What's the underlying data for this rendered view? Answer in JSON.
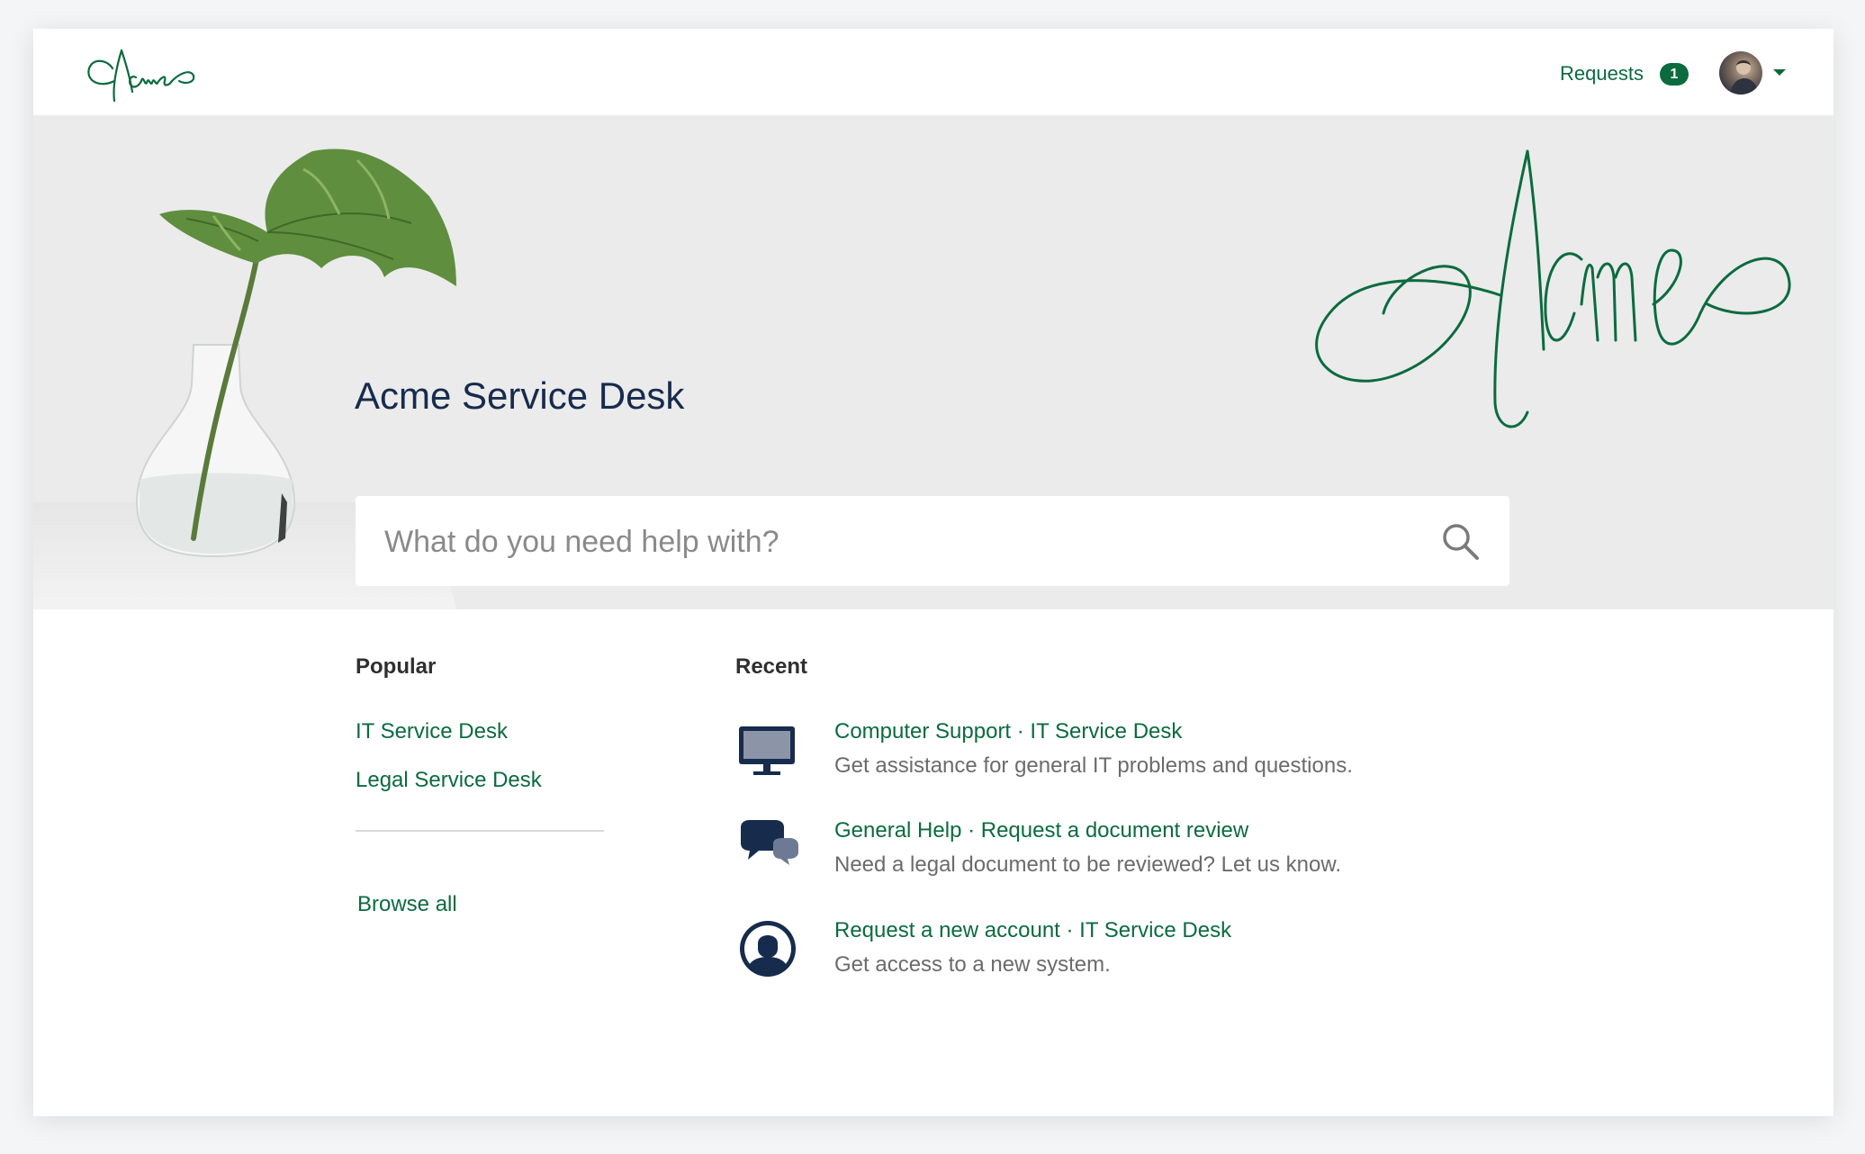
{
  "colors": {
    "brand_green": "#0b6b3f",
    "navy": "#172b4d",
    "banner_bg": "#ebebeb"
  },
  "header": {
    "logo_icon": "acme-script-logo",
    "requests_label": "Requests",
    "requests_count": "1",
    "avatar_icon": "user-avatar"
  },
  "banner": {
    "title": "Acme Service Desk",
    "search_placeholder": "What do you need help with?"
  },
  "popular": {
    "title": "Popular",
    "items": [
      {
        "label": "IT Service Desk"
      },
      {
        "label": "Legal Service Desk"
      }
    ],
    "browse_all": "Browse all"
  },
  "recent": {
    "title": "Recent",
    "items": [
      {
        "icon": "monitor-icon",
        "title": "Computer Support · IT Service Desk",
        "description": "Get assistance for general IT problems and questions."
      },
      {
        "icon": "chat-bubbles-icon",
        "title": "General Help · Request a document review",
        "description": "Need a legal document to be reviewed? Let us know."
      },
      {
        "icon": "user-account-icon",
        "title": "Request a new account · IT Service Desk",
        "description": "Get access to a new system."
      }
    ]
  }
}
